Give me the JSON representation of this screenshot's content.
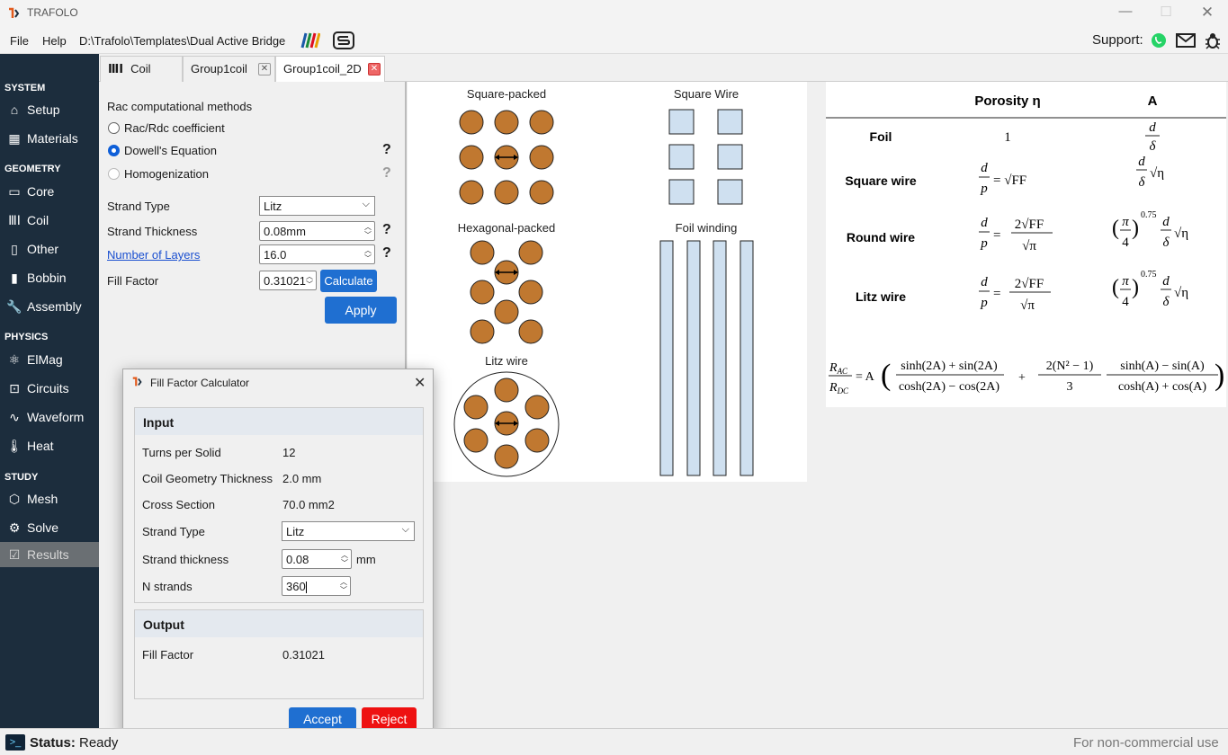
{
  "app": {
    "title": "TRAFOLO"
  },
  "window_controls": {
    "minimize": "—",
    "maximize": "☐",
    "close": "✕"
  },
  "menu": {
    "file": "File",
    "help": "Help",
    "path": "D:\\Trafolo\\Templates\\Dual Active Bridge",
    "support_label": "Support:"
  },
  "sidebar": {
    "sections": [
      "SYSTEM",
      "GEOMETRY",
      "PHYSICS",
      "STUDY"
    ],
    "items": [
      {
        "label": "Setup",
        "icon": "home-icon"
      },
      {
        "label": "Materials",
        "icon": "grid-icon"
      },
      {
        "label": "Core",
        "icon": "core-icon"
      },
      {
        "label": "Coil",
        "icon": "coil-icon"
      },
      {
        "label": "Other",
        "icon": "other-icon"
      },
      {
        "label": "Bobbin",
        "icon": "bobbin-icon"
      },
      {
        "label": "Assembly",
        "icon": "wrench-icon"
      },
      {
        "label": "ElMag",
        "icon": "atom-icon"
      },
      {
        "label": "Circuits",
        "icon": "circuit-icon"
      },
      {
        "label": "Waveform",
        "icon": "wave-icon"
      },
      {
        "label": "Heat",
        "icon": "thermometer-icon"
      },
      {
        "label": "Mesh",
        "icon": "mesh-icon"
      },
      {
        "label": "Solve",
        "icon": "gear-icon"
      },
      {
        "label": "Results",
        "icon": "results-icon"
      }
    ]
  },
  "tabs": [
    {
      "label": "Coil"
    },
    {
      "label": "Group1coil"
    },
    {
      "label": "Group1coil_2D"
    }
  ],
  "panel": {
    "section_title": "Rac computational methods",
    "methods": [
      "Rac/Rdc coefficient",
      "Dowell's Equation",
      "Homogenization"
    ],
    "strand_type_label": "Strand Type",
    "strand_type_value": "Litz",
    "strand_thickness_label": "Strand Thickness",
    "strand_thickness_value": "0.08mm",
    "layers_label": "Number of Layers",
    "layers_value": "16.0",
    "fill_factor_label": "Fill Factor",
    "fill_factor_value": "0.31021",
    "calculate_label": "Calculate",
    "apply_label": "Apply",
    "help_mark": "?"
  },
  "figure": {
    "square_packed": "Square-packed",
    "square_wire": "Square Wire",
    "hex_packed": "Hexagonal-packed",
    "foil_winding": "Foil winding",
    "litz_wire": "Litz wire",
    "colors": {
      "copper": "#c07830",
      "wire_fill": "#cfe0f0"
    }
  },
  "formula_table": {
    "header_porosity": "Porosity η",
    "header_a": "A",
    "rows": [
      "Foil",
      "Square wire",
      "Round wire",
      "Litz wire"
    ],
    "foil_porosity": "1"
  },
  "dialog": {
    "title": "Fill Factor Calculator",
    "input_head": "Input",
    "turns_label": "Turns per Solid",
    "turns_value": "12",
    "geom_label": "Coil Geometry Thickness",
    "geom_value": "2.0 mm",
    "cross_label": "Cross Section",
    "cross_value": "70.0 mm2",
    "strand_type_label": "Strand Type",
    "strand_type_value": "Litz",
    "strand_thick_label": "Strand thickness",
    "strand_thick_value": "0.08",
    "strand_thick_unit": "mm",
    "nstrands_label": "N strands",
    "nstrands_value": "360",
    "output_head": "Output",
    "ff_label": "Fill Factor",
    "ff_value": "0.31021",
    "accept": "Accept",
    "reject": "Reject"
  },
  "status": {
    "label": "Status:",
    "value": "Ready",
    "license": "For non-commercial use"
  },
  "colors": {
    "sidebar": "#1c2d3d",
    "accent": "#1f6fd1",
    "reject": "#ee1111",
    "whatsapp": "#25d366"
  }
}
